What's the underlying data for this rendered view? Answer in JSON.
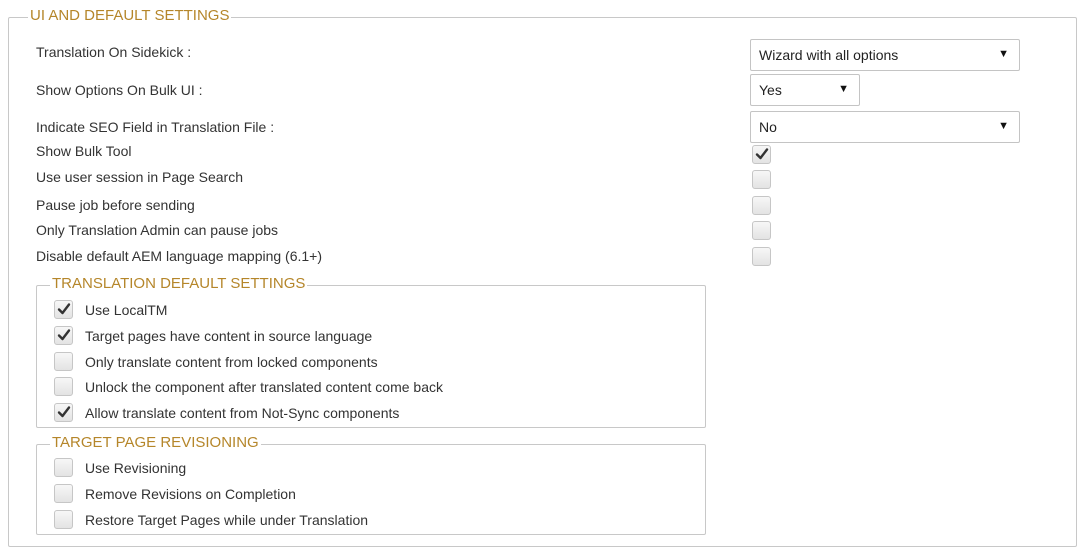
{
  "ui_settings": {
    "title": "UI AND DEFAULT SETTINGS",
    "fields": [
      {
        "label": "Translation On Sidekick :",
        "value": "Wizard with all options"
      },
      {
        "label": "Show Options On Bulk UI :",
        "value": "Yes"
      },
      {
        "label": "Indicate SEO Field in Translation File :",
        "value": "No"
      }
    ],
    "checkboxes": [
      {
        "label": "Show Bulk Tool",
        "checked": true
      },
      {
        "label": "Use user session in Page Search",
        "checked": false
      },
      {
        "label": "Pause job before sending",
        "checked": false
      },
      {
        "label": "Only Translation Admin can pause jobs",
        "checked": false
      },
      {
        "label": "Disable default AEM language mapping (6.1+)",
        "checked": false
      }
    ]
  },
  "translation_defaults": {
    "title": "TRANSLATION DEFAULT SETTINGS",
    "items": [
      {
        "label": "Use LocalTM",
        "checked": true
      },
      {
        "label": "Target pages have content in source language",
        "checked": true
      },
      {
        "label": "Only translate content from locked components",
        "checked": false
      },
      {
        "label": "Unlock the component after translated content come back",
        "checked": false
      },
      {
        "label": "Allow translate content from Not-Sync components",
        "checked": true
      }
    ]
  },
  "revisioning": {
    "title": "TARGET PAGE REVISIONING",
    "items": [
      {
        "label": "Use Revisioning",
        "checked": false
      },
      {
        "label": "Remove Revisions on Completion",
        "checked": false
      },
      {
        "label": "Restore Target Pages while under Translation",
        "checked": false
      }
    ]
  },
  "icons": {
    "dropdown": "▼"
  },
  "colors": {
    "legend": "#b5862a",
    "border": "#c8c8c8",
    "check": "#333333"
  }
}
